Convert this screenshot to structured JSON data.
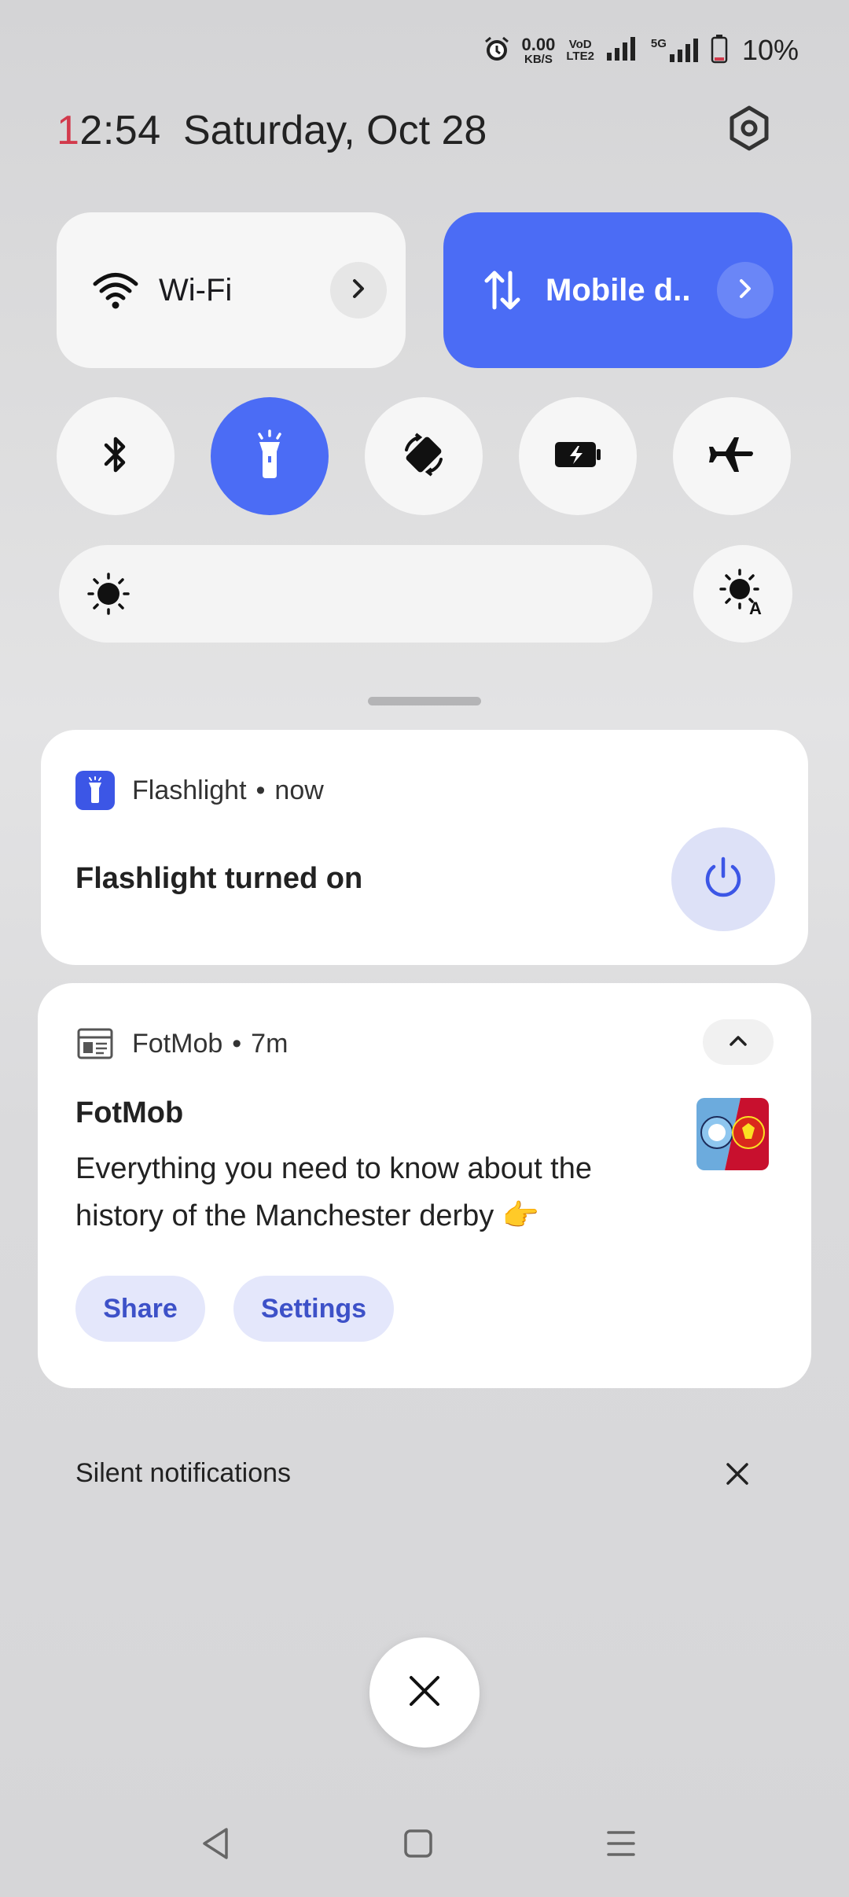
{
  "status_bar": {
    "net_speed_value": "0.00",
    "net_speed_unit": "KB/S",
    "volte_top": "VoD",
    "volte_bottom": "LTE2",
    "network_type": "5G",
    "battery_text": "10%",
    "icons": [
      "alarm-icon",
      "signal-icon",
      "signal-5g-icon",
      "battery-icon"
    ]
  },
  "header": {
    "time_first_digit": "1",
    "time_rest": "2:54",
    "date": "Saturday, Oct 28"
  },
  "tiles": {
    "wifi_label": "Wi-Fi",
    "mobile_label": "Mobile d.."
  },
  "toggles": [
    {
      "name": "bluetooth",
      "active": false
    },
    {
      "name": "flashlight",
      "active": true
    },
    {
      "name": "auto-rotate",
      "active": false
    },
    {
      "name": "battery-saver",
      "active": false
    },
    {
      "name": "airplane-mode",
      "active": false
    }
  ],
  "colors": {
    "accent": "#4b6cf5",
    "clock_first_digit": "#d23a4c",
    "chip_bg": "#e4e7fb",
    "chip_text": "#3d51c8"
  },
  "notifications": [
    {
      "app": "Flashlight",
      "time": "now",
      "title": "Flashlight turned on"
    },
    {
      "app": "FotMob",
      "time": "7m",
      "title": "FotMob",
      "body": "Everything you need to know about the history of the Manchester derby 👉",
      "actions": [
        "Share",
        "Settings"
      ]
    }
  ],
  "silent": {
    "label": "Silent notifications"
  }
}
